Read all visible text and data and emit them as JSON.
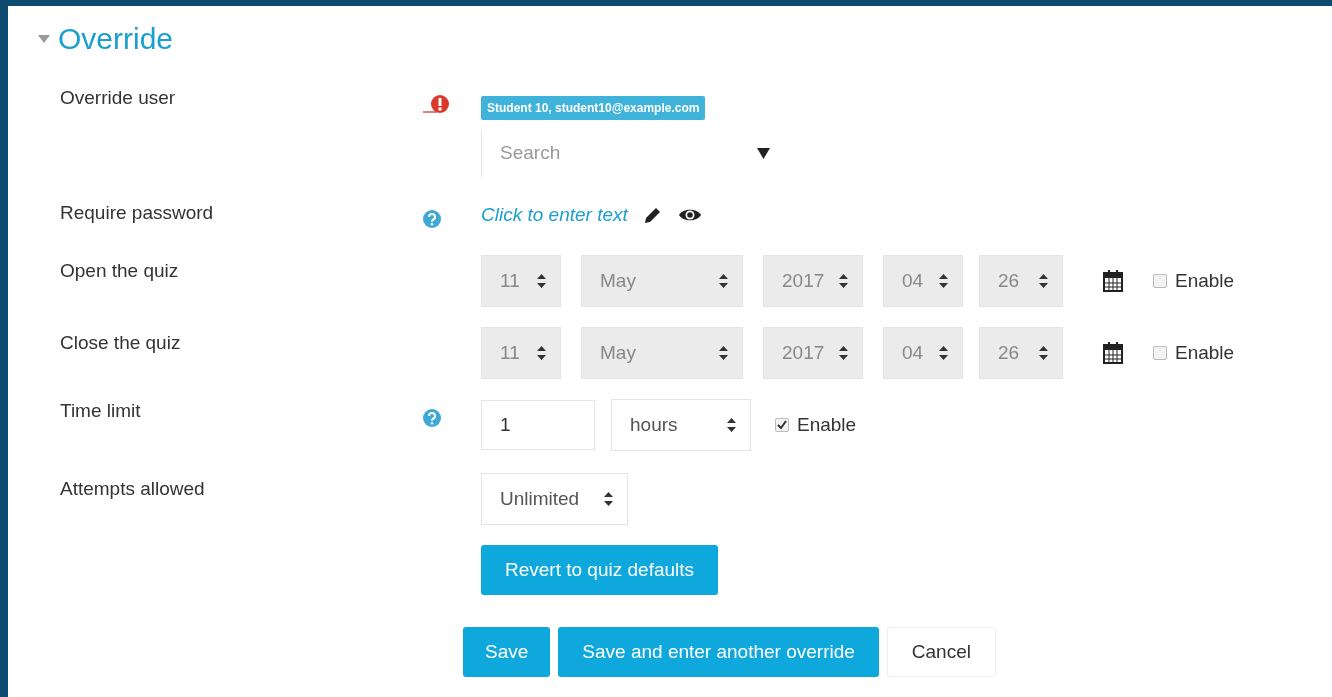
{
  "section": {
    "title": "Override",
    "expanded": true
  },
  "fields": [
    {
      "kind": "autocomplete",
      "label": "Override user",
      "required": true,
      "help": false,
      "tag": "Student 10, student10@example.com",
      "placeholder": "Search"
    },
    {
      "kind": "inplace",
      "label": "Require password",
      "required": false,
      "help": true,
      "text": "Click to enter text"
    },
    {
      "kind": "date",
      "label": "Open the quiz",
      "day": "11",
      "month": "May",
      "year": "2017",
      "hour": "04",
      "minute": "26",
      "enabled": false,
      "enable_label": "Enable"
    },
    {
      "kind": "date",
      "label": "Close the quiz",
      "day": "11",
      "month": "May",
      "year": "2017",
      "hour": "04",
      "minute": "26",
      "enabled": false,
      "enable_label": "Enable"
    },
    {
      "kind": "duration",
      "label": "Time limit",
      "required": false,
      "help": true,
      "value": "1",
      "unit": "hours",
      "enabled": true,
      "enable_label": "Enable"
    },
    {
      "kind": "select",
      "label": "Attempts allowed",
      "value": "Unlimited"
    }
  ],
  "revert_button": "Revert to quiz defaults",
  "buttons": [
    {
      "label": "Save",
      "kind": "primary"
    },
    {
      "label": "Save and enter another override",
      "kind": "primary"
    },
    {
      "label": "Cancel",
      "kind": "secondary"
    }
  ]
}
